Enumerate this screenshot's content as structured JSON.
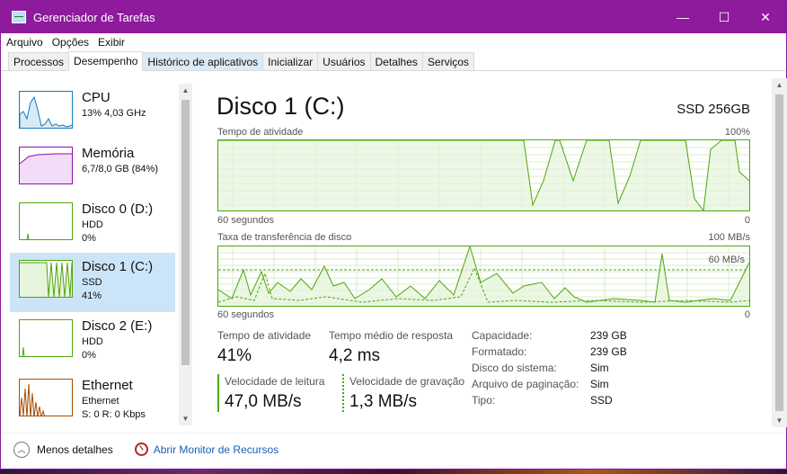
{
  "window": {
    "title": "Gerenciador de Tarefas",
    "minimize": "—",
    "maximize": "☐",
    "close": "✕"
  },
  "menu": [
    "Arquivo",
    "Opções",
    "Exibir"
  ],
  "tabs": [
    "Processos",
    "Desempenho",
    "Histórico de aplicativos",
    "Inicializar",
    "Usuários",
    "Detalhes",
    "Serviços"
  ],
  "sidebar": [
    {
      "name": "CPU",
      "sub1": "13% 4,03 GHz",
      "sub2": "",
      "color": "#117dbb"
    },
    {
      "name": "Memória",
      "sub1": "6,7/8,0 GB (84%)",
      "sub2": "",
      "color": "#8b12ae"
    },
    {
      "name": "Disco 0 (D:)",
      "sub1": "HDD",
      "sub2": "0%",
      "color": "#4da60c"
    },
    {
      "name": "Disco 1 (C:)",
      "sub1": "SSD",
      "sub2": "41%",
      "color": "#4da60c"
    },
    {
      "name": "Disco 2 (E:)",
      "sub1": "HDD",
      "sub2": "0%",
      "color": "#4da60c"
    },
    {
      "name": "Ethernet",
      "sub1": "Ethernet",
      "sub2": "S: 0 R: 0 Kbps",
      "color": "#a74f01"
    }
  ],
  "main": {
    "title": "Disco 1 (C:)",
    "model": "SSD 256GB",
    "graph1": {
      "label": "Tempo de atividade",
      "max": "100%",
      "xlabel": "60 segundos",
      "min": "0"
    },
    "graph2": {
      "label": "Taxa de transferência de disco",
      "max": "100 MB/s",
      "ref": "60 MB/s",
      "xlabel": "60 segundos",
      "min": "0"
    },
    "stats": {
      "active_label": "Tempo de atividade",
      "active_value": "41%",
      "response_label": "Tempo médio de resposta",
      "response_value": "4,2 ms",
      "read_label": "Velocidade de leitura",
      "read_value": "47,0 MB/s",
      "write_label": "Velocidade de gravação",
      "write_value": "1,3 MB/s"
    },
    "props": [
      {
        "key": "Capacidade:",
        "value": "239 GB"
      },
      {
        "key": "Formatado:",
        "value": "239 GB"
      },
      {
        "key": "Disco do sistema:",
        "value": "Sim"
      },
      {
        "key": "Arquivo de paginação:",
        "value": "Sim"
      },
      {
        "key": "Tipo:",
        "value": "SSD"
      }
    ]
  },
  "footer": {
    "less": "Menos detalhes",
    "resmon": "Abrir Monitor de Recursos"
  }
}
